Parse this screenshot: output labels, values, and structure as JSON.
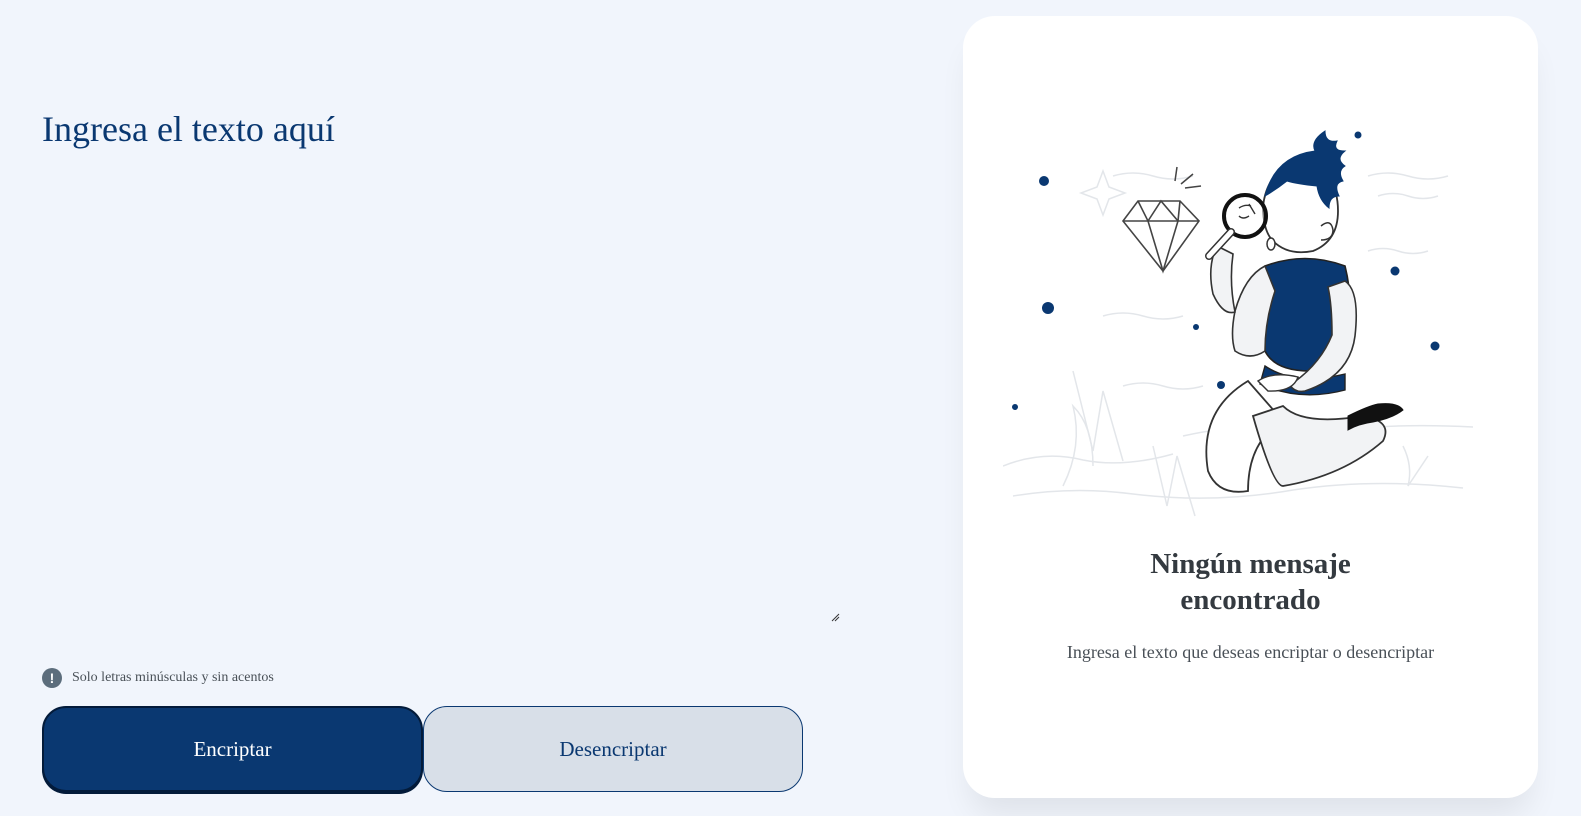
{
  "input": {
    "placeholder": "Ingresa el texto aquí",
    "value": ""
  },
  "hint": {
    "icon": "exclamation-circle-icon",
    "text": "Solo letras minúsculas y sin acentos"
  },
  "buttons": {
    "encrypt_label": "Encriptar",
    "decrypt_label": "Desencriptar"
  },
  "output": {
    "illustration": "person-with-magnifier-illustration",
    "title_line1": "Ningún mensaje",
    "title_line2": "encontrado",
    "subtitle": "Ingresa el texto que deseas encriptar o desencriptar"
  },
  "colors": {
    "background": "#f1f5fc",
    "primary": "#0a3871",
    "secondary_button": "#d8dfe8",
    "card": "#ffffff",
    "text_dark": "#343a40",
    "text_muted": "#495057"
  }
}
